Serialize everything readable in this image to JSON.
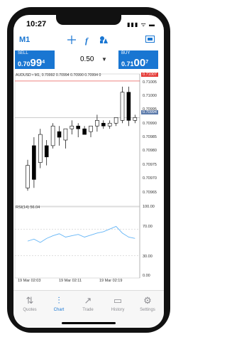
{
  "status": {
    "time": "10:27",
    "icons": "▮▮▮ ᯤ ▬"
  },
  "toolbar": {
    "timeframe": "M1",
    "crosshair_icon": "crosshair-icon",
    "indicator_label": "f",
    "objects_icon": "objects-icon",
    "messages_icon": "messages-icon"
  },
  "trade": {
    "sell_label": "SELL",
    "sell_prefix": "0.70",
    "sell_big": "99",
    "sell_sup": "4",
    "buy_label": "BUY",
    "buy_prefix": "0.71",
    "buy_big": "00",
    "buy_sup": "7",
    "volume": "0.50",
    "volume_arrow": "▼"
  },
  "chart": {
    "symbol_line": "AUDUSD • M1, 0.70992 0.70994 0.70990 0.70994 0",
    "red_price": "0.71007",
    "current_price": "0.70994",
    "y_ticks": [
      "0.71005",
      "0.71000",
      "0.70995",
      "0.70990",
      "0.70985",
      "0.70980",
      "0.70975",
      "0.70970",
      "0.70965"
    ],
    "rsi_label": "RSI(14) 56.04",
    "rsi_ticks": [
      "100.00",
      "70.00",
      "30.00",
      "0.00"
    ],
    "x_ticks": [
      "19 Mar 02:03",
      "19 Mar 02:11",
      "19 Mar 02:19"
    ],
    "colors": {
      "bull": "#ffffff",
      "bear": "#000000",
      "rsi": "#64b5f6",
      "sell": "#1976d2"
    }
  },
  "chart_data": {
    "type": "candlestick",
    "symbol": "AUDUSD",
    "timeframe": "M1",
    "ylim": [
      0.70963,
      0.71009
    ],
    "candles": [
      {
        "o": 0.70969,
        "h": 0.70979,
        "l": 0.70968,
        "c": 0.70977
      },
      {
        "o": 0.70984,
        "h": 0.70987,
        "l": 0.70969,
        "c": 0.70972
      },
      {
        "o": 0.70978,
        "h": 0.7099,
        "l": 0.70976,
        "c": 0.70988
      },
      {
        "o": 0.70984,
        "h": 0.70986,
        "l": 0.70977,
        "c": 0.7098
      },
      {
        "o": 0.70984,
        "h": 0.70992,
        "l": 0.70983,
        "c": 0.70991
      },
      {
        "o": 0.70989,
        "h": 0.70991,
        "l": 0.70984,
        "c": 0.70987
      },
      {
        "o": 0.70986,
        "h": 0.7099,
        "l": 0.70983,
        "c": 0.7099
      },
      {
        "o": 0.7099,
        "h": 0.70993,
        "l": 0.70988,
        "c": 0.70991
      },
      {
        "o": 0.70991,
        "h": 0.70992,
        "l": 0.70987,
        "c": 0.7099
      },
      {
        "o": 0.7099,
        "h": 0.70991,
        "l": 0.70988,
        "c": 0.70988
      },
      {
        "o": 0.70989,
        "h": 0.70991,
        "l": 0.70987,
        "c": 0.70991
      },
      {
        "o": 0.70991,
        "h": 0.70995,
        "l": 0.70989,
        "c": 0.70993
      },
      {
        "o": 0.70992,
        "h": 0.70993,
        "l": 0.7099,
        "c": 0.70991
      },
      {
        "o": 0.70991,
        "h": 0.70993,
        "l": 0.7099,
        "c": 0.70992
      },
      {
        "o": 0.70992,
        "h": 0.70994,
        "l": 0.70991,
        "c": 0.70994
      },
      {
        "o": 0.70993,
        "h": 0.71005,
        "l": 0.70992,
        "c": 0.71003
      },
      {
        "o": 0.71003,
        "h": 0.71005,
        "l": 0.70991,
        "c": 0.70993
      },
      {
        "o": 0.70993,
        "h": 0.70995,
        "l": 0.70992,
        "c": 0.70994
      }
    ],
    "rsi": [
      52,
      55,
      50,
      56,
      60,
      63,
      58,
      60,
      62,
      58,
      61,
      64,
      66,
      70,
      74,
      64,
      58,
      56
    ],
    "rsi_ylim": [
      0,
      100
    ]
  },
  "tabs": [
    {
      "label": "Quotes",
      "icon": "⇅"
    },
    {
      "label": "Chart",
      "icon": "⫶"
    },
    {
      "label": "Trade",
      "icon": "↗"
    },
    {
      "label": "History",
      "icon": "▭"
    },
    {
      "label": "Settings",
      "icon": "⚙"
    }
  ]
}
